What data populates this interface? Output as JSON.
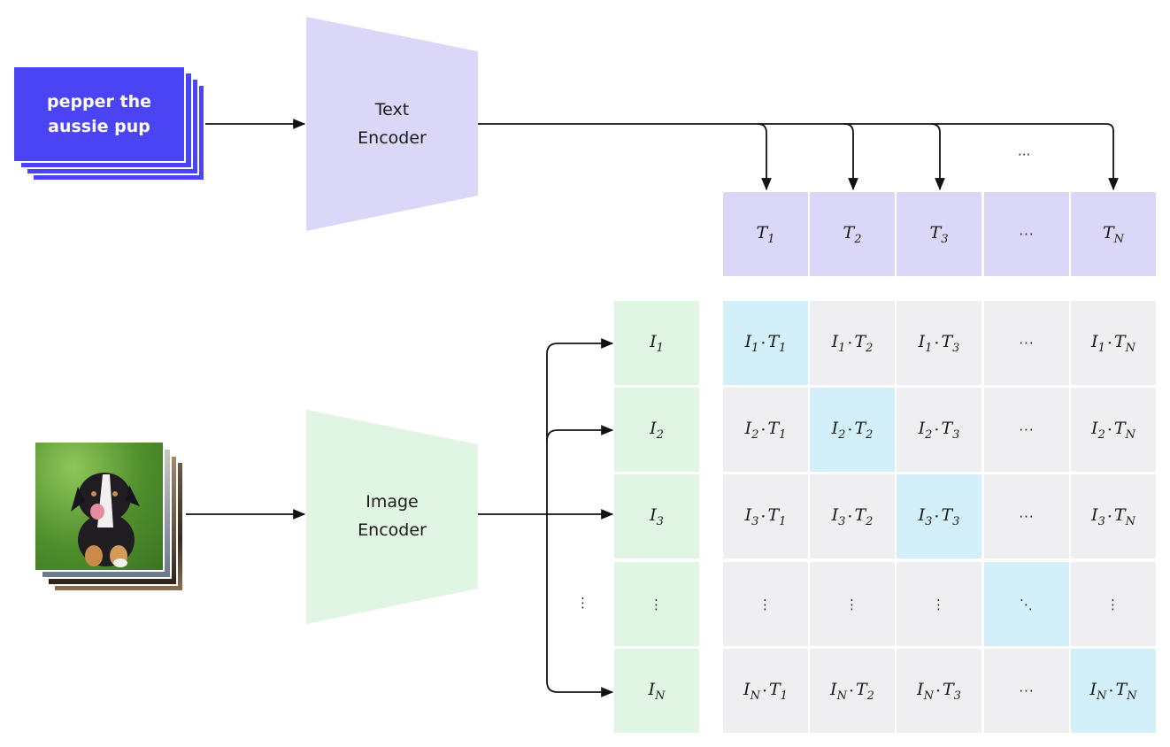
{
  "text_input": {
    "caption": "pepper the\naussie pup",
    "card_color": "#4B44F5"
  },
  "image_input": {
    "subject": "puppy photo on grass",
    "stack_count": 4
  },
  "text_encoder": {
    "label": "Text\nEncoder",
    "color": "#DBD7F8"
  },
  "image_encoder": {
    "label": "Image\nEncoder",
    "color": "#E0F5E3"
  },
  "ellipsis_h": "···",
  "ellipsis_v": "⋮",
  "ellipsis_diag": "⋱",
  "text_embeddings": [
    {
      "base": "T",
      "sub": "1"
    },
    {
      "base": "T",
      "sub": "2"
    },
    {
      "base": "T",
      "sub": "3"
    },
    {
      "ellipsis": "···"
    },
    {
      "base": "T",
      "sub": "N"
    }
  ],
  "image_embeddings": [
    {
      "base": "I",
      "sub": "1"
    },
    {
      "base": "I",
      "sub": "2"
    },
    {
      "base": "I",
      "sub": "3"
    },
    {
      "ellipsis": "⋮"
    },
    {
      "base": "I",
      "sub": "N"
    }
  ],
  "matrix": {
    "row_subs": [
      "1",
      "2",
      "3",
      "",
      "N"
    ],
    "col_subs": [
      "1",
      "2",
      "3",
      "",
      "N"
    ],
    "diagonal_color": "#D3EFFA",
    "offdiag_color": "#EFEFF1",
    "text_color": "#DBD7F8"
  }
}
